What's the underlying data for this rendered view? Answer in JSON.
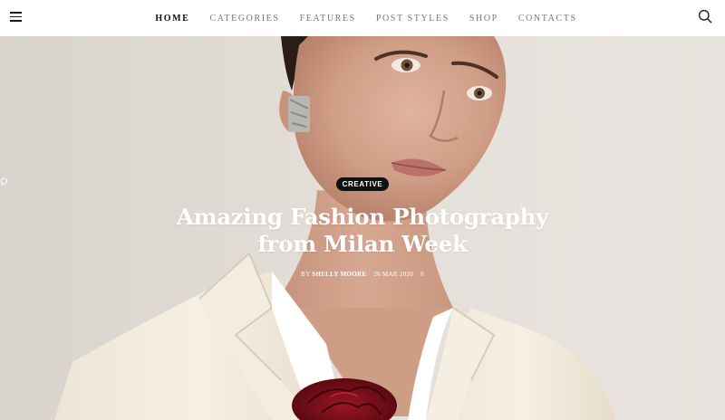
{
  "nav": {
    "items": [
      {
        "label": "HOME",
        "active": true
      },
      {
        "label": "CATEGORIES",
        "active": false
      },
      {
        "label": "FEATURES",
        "active": false
      },
      {
        "label": "POST STYLES",
        "active": false
      },
      {
        "label": "SHOP",
        "active": false
      },
      {
        "label": "CONTACTS",
        "active": false
      }
    ],
    "menu_icon": "hamburger-icon",
    "search_icon": "search-icon"
  },
  "hero": {
    "category": "CREATIVE",
    "title": "Amazing Fashion Photography from Milan Week",
    "author_prefix": "BY",
    "author": "SHELLY MOORE",
    "date": "26 MAR 2020",
    "comments_count": "0",
    "comment_icon": "comment-bubble-icon"
  },
  "colors": {
    "background": "#ffffff",
    "nav_active": "#111111",
    "nav_inactive": "#777777",
    "badge_bg": "#111111",
    "hero_text": "#ffffff"
  }
}
